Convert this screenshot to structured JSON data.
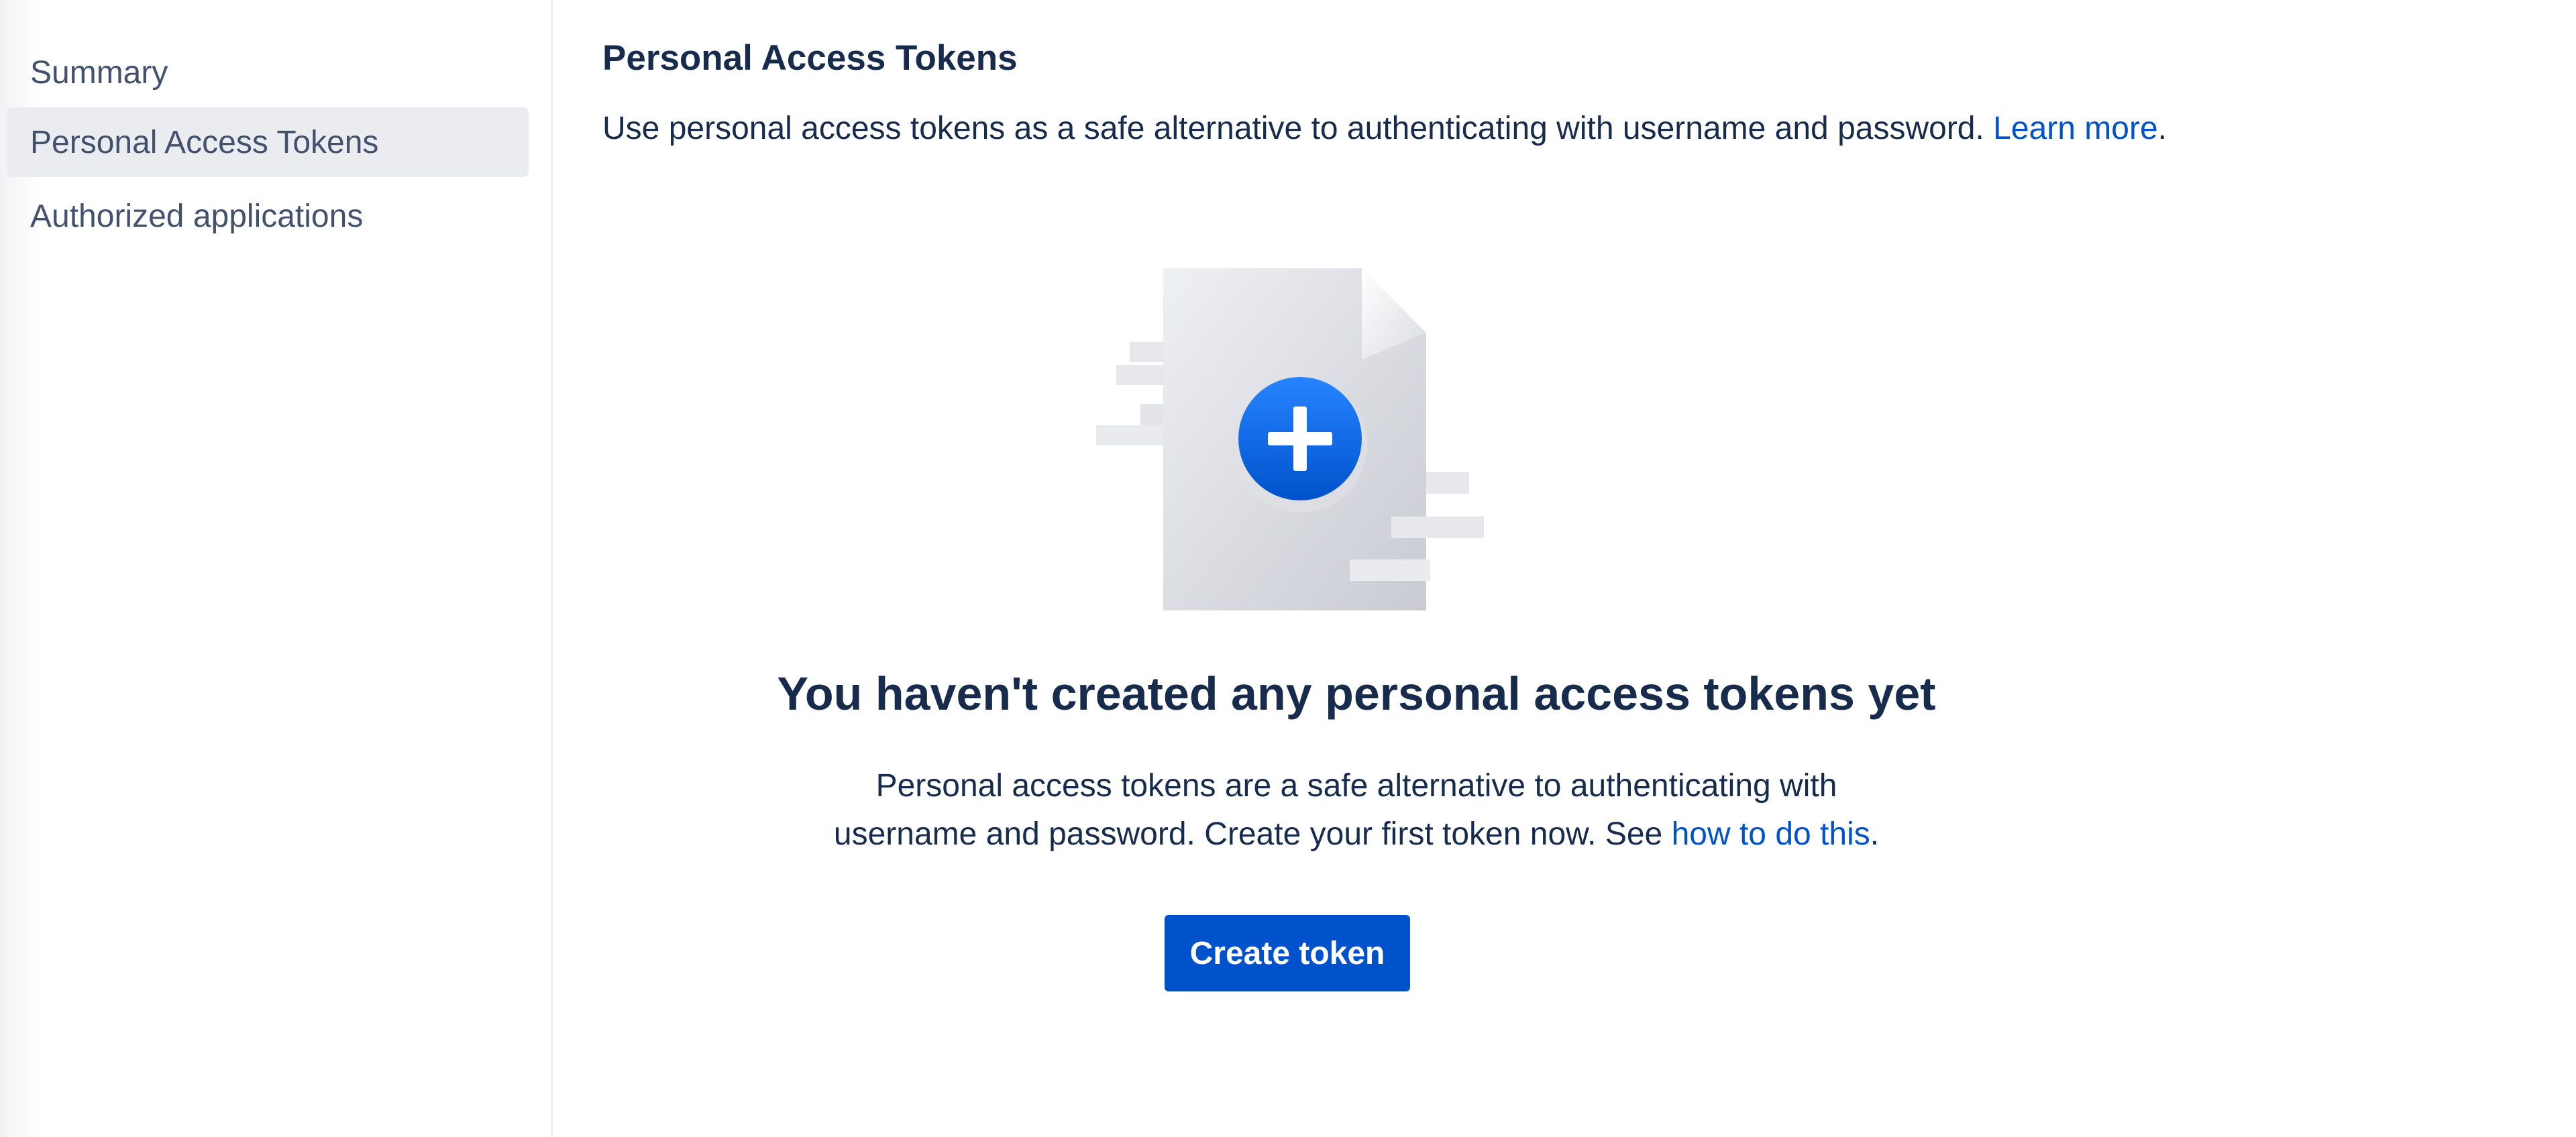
{
  "sidebar": {
    "items": [
      {
        "label": "Summary",
        "selected": false
      },
      {
        "label": "Personal Access Tokens",
        "selected": true
      },
      {
        "label": "Authorized applications",
        "selected": false
      }
    ]
  },
  "main": {
    "title": "Personal Access Tokens",
    "description": "Use personal access tokens as a safe alternative to authenticating with username and password. ",
    "description_link": "Learn more",
    "description_end": "."
  },
  "empty_state": {
    "illustration_icon": "document-plus-icon",
    "heading": "You haven't created any personal access tokens yet",
    "text_line1": "Personal access tokens are a safe alternative to authenticating with",
    "text_line2": "username and password. Create your first token now. See ",
    "text_link": "how to do this",
    "text_end": ".",
    "button_label": "Create token"
  },
  "colors": {
    "accent": "#0052cc",
    "text": "#172b4d",
    "nav_text": "#42526e",
    "nav_selected_bg": "#ebecf0"
  }
}
